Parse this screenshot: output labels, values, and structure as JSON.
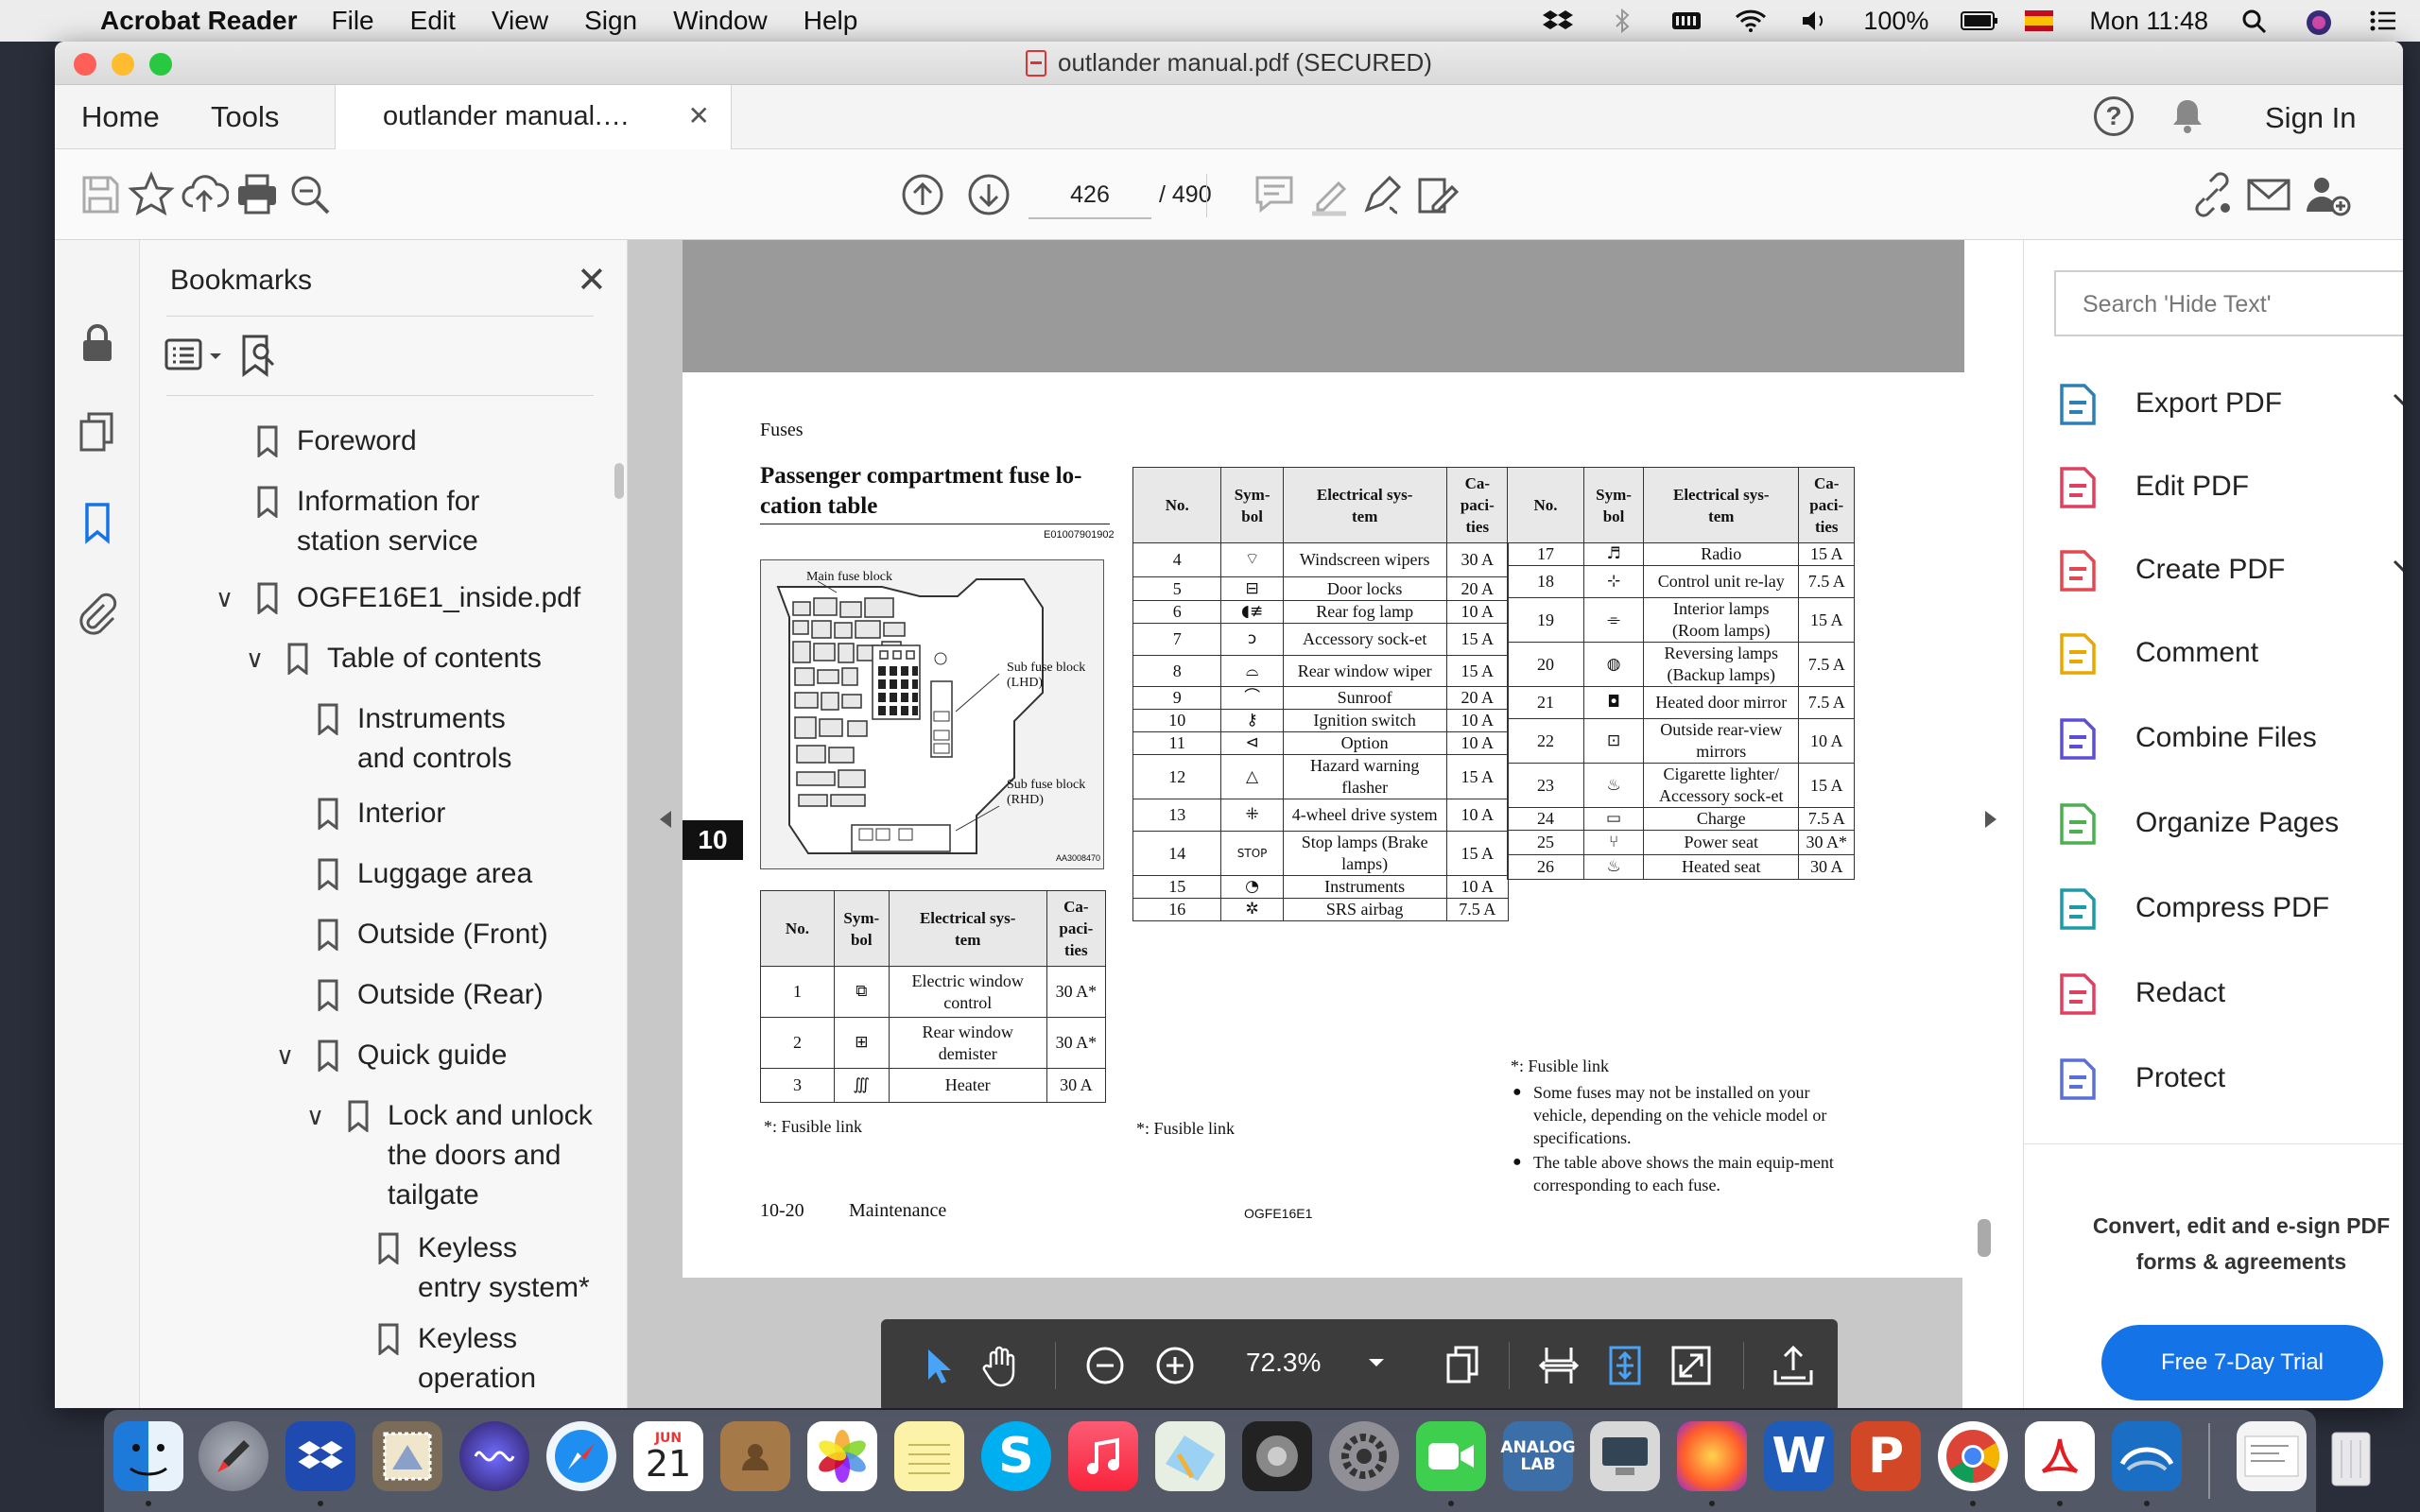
{
  "menubar": {
    "app_name": "Acrobat Reader",
    "menus": [
      "File",
      "Edit",
      "View",
      "Sign",
      "Window",
      "Help"
    ],
    "battery": "100%",
    "clock": "Mon 11:48"
  },
  "window": {
    "title": "outlander manual.pdf (SECURED)"
  },
  "tabs": {
    "home": "Home",
    "tools": "Tools",
    "document": "outlander manual.…",
    "sign_in": "Sign In"
  },
  "toolbar": {
    "current_page": "426",
    "total_pages": "/ 490"
  },
  "bookmarks": {
    "title": "Bookmarks",
    "items": [
      {
        "label": "Foreword"
      },
      {
        "label": "Information for",
        "label2": "station service"
      },
      {
        "label": "OGFE16E1_inside.pdf"
      },
      {
        "label": "Table of contents"
      },
      {
        "label": "Instruments",
        "label2": "and controls"
      },
      {
        "label": "Interior"
      },
      {
        "label": "Luggage area"
      },
      {
        "label": "Outside (Front)"
      },
      {
        "label": "Outside (Rear)"
      },
      {
        "label": "Quick guide"
      },
      {
        "label": "Lock and unlock",
        "label2": "the doors and",
        "label3": "tailgate"
      },
      {
        "label": "Keyless",
        "label2": "entry system*"
      },
      {
        "label": "Keyless",
        "label2": "operation"
      }
    ]
  },
  "page": {
    "header": "Fuses",
    "title": "Passenger compartment fuse lo-cation table",
    "title_line1": "Passenger compartment fuse lo-",
    "title_line2": "cation table",
    "code": "E01007901902",
    "diagram": {
      "main": "Main fuse block",
      "sub_lhd_1": "Sub fuse block",
      "sub_lhd_2": "(LHD)",
      "sub_rhd_1": "Sub fuse block",
      "sub_rhd_2": "(RHD)",
      "ref": "AA3008470"
    },
    "tab_number": "10",
    "headers": {
      "no": "No.",
      "symbol": "Sym-bol",
      "system": "Electrical sys-tem",
      "capacities": "Ca-paci-ties"
    },
    "table1": [
      {
        "no": "1",
        "sym": "⧉",
        "name": "Electric window control",
        "cap": "30 A*"
      },
      {
        "no": "2",
        "sym": "⊞",
        "name": "Rear window demister",
        "cap": "30 A*"
      },
      {
        "no": "3",
        "sym": "∭",
        "name": "Heater",
        "cap": "30 A"
      }
    ],
    "table2": [
      {
        "no": "4",
        "sym": "⌔",
        "name": "Windscreen wipers",
        "cap": "30 A"
      },
      {
        "no": "5",
        "sym": "⊟",
        "name": "Door locks",
        "cap": "20 A"
      },
      {
        "no": "6",
        "sym": "◖≢",
        "name": "Rear fog lamp",
        "cap": "10 A"
      },
      {
        "no": "7",
        "sym": "ↄ",
        "name": "Accessory sock-et",
        "cap": "15 A"
      },
      {
        "no": "8",
        "sym": "⌓",
        "name": "Rear window wiper",
        "cap": "15 A"
      },
      {
        "no": "9",
        "sym": "⌒",
        "name": "Sunroof",
        "cap": "20 A"
      },
      {
        "no": "10",
        "sym": "⚷",
        "name": "Ignition switch",
        "cap": "10 A"
      },
      {
        "no": "11",
        "sym": "⊲",
        "name": "Option",
        "cap": "10 A"
      },
      {
        "no": "12",
        "sym": "△",
        "name": "Hazard warning flasher",
        "cap": "15 A"
      },
      {
        "no": "13",
        "sym": "⁜",
        "name": "4-wheel drive system",
        "cap": "10 A"
      },
      {
        "no": "14",
        "sym": "STOP",
        "name": "Stop lamps (Brake lamps)",
        "cap": "15 A"
      },
      {
        "no": "15",
        "sym": "◔",
        "name": "Instruments",
        "cap": "10 A"
      },
      {
        "no": "16",
        "sym": "✲",
        "name": "SRS airbag",
        "cap": "7.5 A"
      }
    ],
    "table3": [
      {
        "no": "17",
        "sym": "♬",
        "name": "Radio",
        "cap": "15 A"
      },
      {
        "no": "18",
        "sym": "⊹",
        "name": "Control unit re-lay",
        "cap": "7.5 A"
      },
      {
        "no": "19",
        "sym": "⌯",
        "name": "Interior lamps (Room lamps)",
        "cap": "15 A"
      },
      {
        "no": "20",
        "sym": "◍",
        "name": "Reversing lamps (Backup lamps)",
        "cap": "7.5 A"
      },
      {
        "no": "21",
        "sym": "◘",
        "name": "Heated door mirror",
        "cap": "7.5 A"
      },
      {
        "no": "22",
        "sym": "⊡",
        "name": "Outside rear-view mirrors",
        "cap": "10 A"
      },
      {
        "no": "23",
        "sym": "♨",
        "name": "Cigarette lighter/ Accessory sock-et",
        "cap": "15 A"
      },
      {
        "no": "24",
        "sym": "▭",
        "name": "Charge",
        "cap": "7.5 A"
      },
      {
        "no": "25",
        "sym": "⑂",
        "name": "Power seat",
        "cap": "30 A*"
      },
      {
        "no": "26",
        "sym": "♨",
        "name": "Heated seat",
        "cap": "30 A"
      }
    ],
    "fusible_link": "*: Fusible link",
    "note1": "Some fuses may not be installed on your vehicle, depending on the vehicle model or specifications.",
    "note2": "The table above shows the main equip-ment corresponding to each fuse.",
    "footer_page": "10-20",
    "footer_section": "Maintenance",
    "footer_code": "OGFE16E1"
  },
  "float_toolbar": {
    "zoom": "72.3%"
  },
  "right_panel": {
    "search_placeholder": "Search 'Hide Text'",
    "items": [
      {
        "label": "Export PDF",
        "color": "#2d7fb8"
      },
      {
        "label": "Edit PDF",
        "color": "#e0405e"
      },
      {
        "label": "Create PDF",
        "color": "#e34850"
      },
      {
        "label": "Comment",
        "color": "#e8a800"
      },
      {
        "label": "Combine Files",
        "color": "#5b4fd8"
      },
      {
        "label": "Organize Pages",
        "color": "#4caf50"
      },
      {
        "label": "Compress PDF",
        "color": "#1d9aa8"
      },
      {
        "label": "Redact",
        "color": "#e0405e"
      },
      {
        "label": "Protect",
        "color": "#5b6fd8"
      }
    ],
    "promo": "Convert, edit and e-sign PDF forms & agreements",
    "promo_line1": "Convert, edit and e-sign PDF",
    "promo_line2": "forms & agreements",
    "cta": "Free 7-Day Trial"
  },
  "dock": {
    "calendar_month": "JUN",
    "calendar_day": "21",
    "analog_lab": "ANALOG LAB",
    "analog_line1": "ANALOG",
    "analog_line2": "LAB"
  }
}
